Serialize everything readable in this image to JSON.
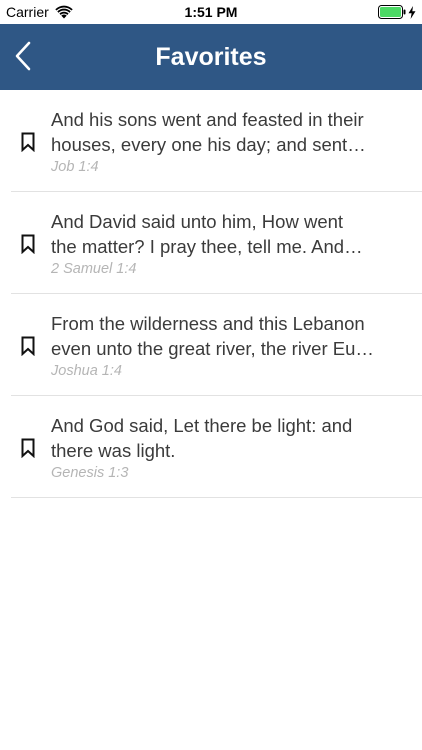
{
  "status_bar": {
    "carrier": "Carrier",
    "time": "1:51 PM",
    "battery_color": "#4cd964"
  },
  "nav": {
    "title": "Favorites",
    "back_icon": "chevron-left-icon",
    "background_color": "#2f5785"
  },
  "favorites": [
    {
      "line1": "And his sons went and feasted in their",
      "line2": "houses, every one his day; and sent…",
      "reference": "Job 1:4",
      "icon": "bookmark-icon"
    },
    {
      "line1": "And David said unto him, How went",
      "line2": "the matter? I pray thee, tell me. And…",
      "reference": "2 Samuel 1:4",
      "icon": "bookmark-icon"
    },
    {
      "line1": "From the wilderness and this Lebanon",
      "line2": "even unto the great river, the river Eu…",
      "reference": "Joshua 1:4",
      "icon": "bookmark-icon"
    },
    {
      "line1": "And God said, Let there be light: and",
      "line2": "there was light.",
      "reference": "Genesis 1:3",
      "icon": "bookmark-icon"
    }
  ]
}
